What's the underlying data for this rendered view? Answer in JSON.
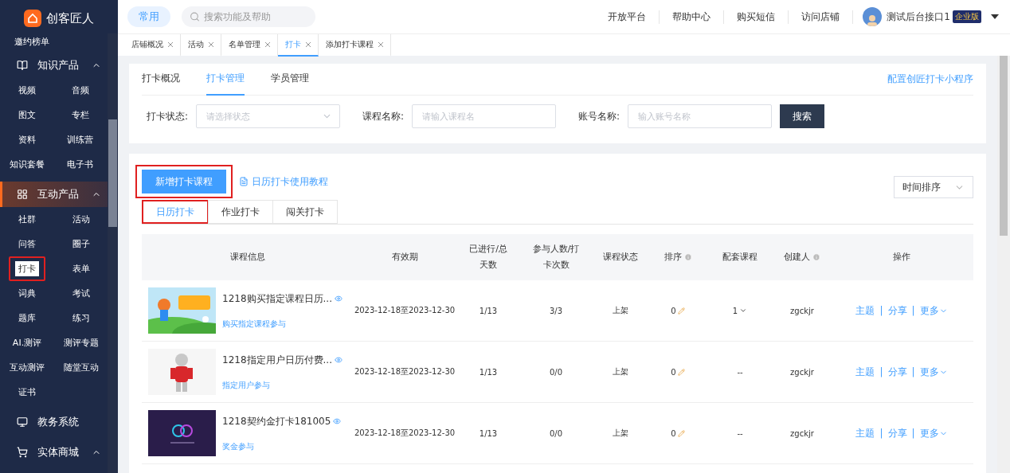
{
  "sidebar": {
    "logo": "创客匠人",
    "cut_item": "邀约榜单",
    "groups": [
      {
        "title": "知识产品",
        "kind": "book",
        "expanded": true,
        "active": false,
        "items": [
          {
            "label": "视频",
            "selected": false,
            "annotated": false
          },
          {
            "label": "音频",
            "selected": false,
            "annotated": false
          },
          {
            "label": "图文",
            "selected": false,
            "annotated": false
          },
          {
            "label": "专栏",
            "selected": false,
            "annotated": false
          },
          {
            "label": "资料",
            "selected": false,
            "annotated": false
          },
          {
            "label": "训练营",
            "selected": false,
            "annotated": false
          },
          {
            "label": "知识套餐",
            "selected": false,
            "annotated": false
          },
          {
            "label": "电子书",
            "selected": false,
            "annotated": false
          }
        ]
      },
      {
        "title": "互动产品",
        "kind": "grid",
        "expanded": true,
        "active": true,
        "items": [
          {
            "label": "社群",
            "selected": false,
            "annotated": false
          },
          {
            "label": "活动",
            "selected": false,
            "annotated": false
          },
          {
            "label": "问答",
            "selected": false,
            "annotated": false
          },
          {
            "label": "圈子",
            "selected": false,
            "annotated": false
          },
          {
            "label": "打卡",
            "selected": true,
            "annotated": true
          },
          {
            "label": "表单",
            "selected": false,
            "annotated": false
          },
          {
            "label": "词典",
            "selected": false,
            "annotated": false
          },
          {
            "label": "考试",
            "selected": false,
            "annotated": false
          },
          {
            "label": "题库",
            "selected": false,
            "annotated": false
          },
          {
            "label": "练习",
            "selected": false,
            "annotated": false
          },
          {
            "label": "AI.测评",
            "selected": false,
            "annotated": false
          },
          {
            "label": "测评专题",
            "selected": false,
            "annotated": false
          },
          {
            "label": "互动测评",
            "selected": false,
            "annotated": false
          },
          {
            "label": "随堂互动",
            "selected": false,
            "annotated": false
          },
          {
            "label": "证书",
            "selected": false,
            "annotated": false
          }
        ]
      },
      {
        "title": "教务系统",
        "kind": "screen",
        "active": false
      },
      {
        "title": "实体商城",
        "kind": "cart",
        "expanded": true,
        "active": false
      }
    ]
  },
  "topbar": {
    "common": "常用",
    "search_placeholder": "搜索功能及帮助",
    "links": [
      "开放平台",
      "帮助中心",
      "购买短信",
      "访问店铺"
    ],
    "user": "测试后台接口1",
    "badge": "企业版"
  },
  "page_tabs": [
    {
      "label": "店铺概况",
      "selected": false
    },
    {
      "label": "活动",
      "selected": false
    },
    {
      "label": "名单管理",
      "selected": false
    },
    {
      "label": "打卡",
      "selected": true
    },
    {
      "label": "添加打卡课程",
      "selected": false
    }
  ],
  "sub_tabs": [
    {
      "label": "打卡概况",
      "selected": false
    },
    {
      "label": "打卡管理",
      "selected": true
    },
    {
      "label": "学员管理",
      "selected": false
    }
  ],
  "config_link": "配置创匠打卡小程序",
  "filters": [
    {
      "label": "打卡状态:",
      "placeholder": "请选择状态",
      "kind": "select"
    },
    {
      "label": "课程名称:",
      "placeholder": "请输入课程名",
      "kind": "input"
    },
    {
      "label": "账号名称:",
      "placeholder": "输入账号名称",
      "kind": "input"
    }
  ],
  "search_button": "搜索",
  "add_button": {
    "label": "新增打卡课程",
    "annotated": true
  },
  "tutorial_link": "日历打卡使用教程",
  "sort_select": "时间排序",
  "type_tabs": [
    {
      "label": "日历打卡",
      "selected": true,
      "annotated": true
    },
    {
      "label": "作业打卡",
      "selected": false,
      "annotated": false
    },
    {
      "label": "闯关打卡",
      "selected": false,
      "annotated": false
    }
  ],
  "table": {
    "columns": [
      {
        "label": "课程信息",
        "info": false
      },
      {
        "label": "有效期",
        "info": false
      },
      {
        "label": "已进行/总天数",
        "info": false
      },
      {
        "label": "参与人数/打卡次数",
        "info": false
      },
      {
        "label": "课程状态",
        "info": false
      },
      {
        "label": "排序",
        "info": true
      },
      {
        "label": "配套课程",
        "info": false
      },
      {
        "label": "创建人",
        "info": true
      },
      {
        "label": "操作",
        "info": false
      }
    ],
    "rows": [
      {
        "title": "1218购买指定课程日历...",
        "join": "购买指定课程参与",
        "period": "2023-12-18至2023-12-30",
        "progress": "1/13",
        "counts": "3/3",
        "status": "上架",
        "sort": "0",
        "bundle": "1",
        "bundle_dropdown": true,
        "creator": "zgckjr",
        "actions": [
          "主题",
          "分享",
          "更多"
        ],
        "separator": "|"
      },
      {
        "title": "1218指定用户日历付费...",
        "join": "指定用户参与",
        "period": "2023-12-18至2023-12-30",
        "progress": "1/13",
        "counts": "0/0",
        "status": "上架",
        "sort": "0",
        "bundle": "--",
        "bundle_dropdown": false,
        "creator": "zgckjr",
        "actions": [
          "主题",
          "分享",
          "更多"
        ],
        "separator": "|"
      },
      {
        "title": "1218契约金打卡181005",
        "join": "奖金参与",
        "period": "2023-12-18至2023-12-30",
        "progress": "1/13",
        "counts": "0/0",
        "status": "上架",
        "sort": "0",
        "bundle": "--",
        "bundle_dropdown": false,
        "creator": "zgckjr",
        "actions": [
          "主题",
          "分享",
          "更多"
        ],
        "separator": "|"
      }
    ]
  }
}
